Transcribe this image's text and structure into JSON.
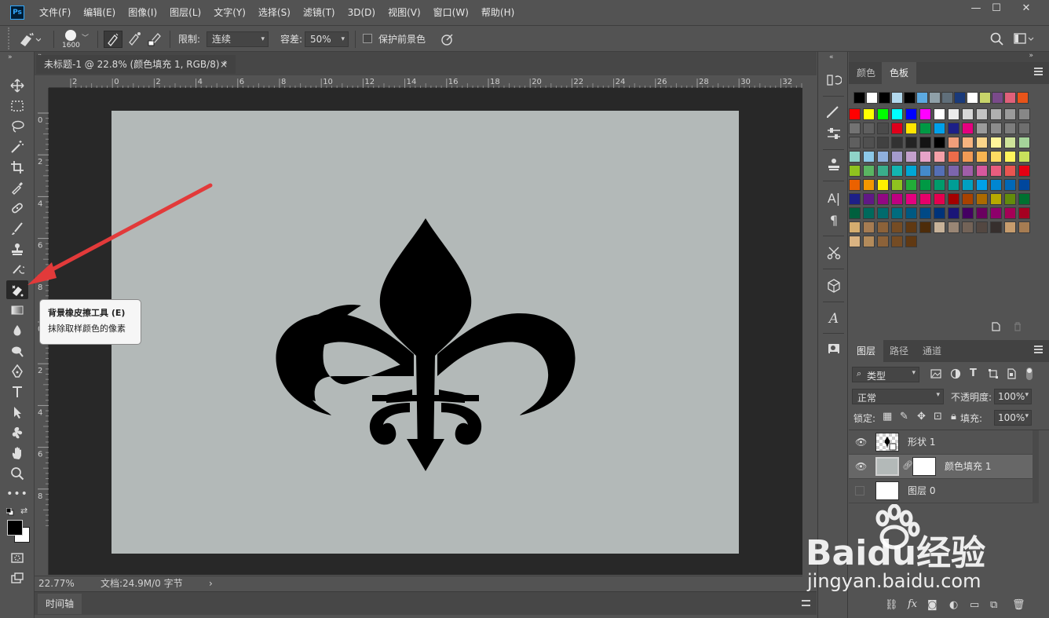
{
  "app": {
    "logo": "Ps",
    "menu": [
      "文件(F)",
      "编辑(E)",
      "图像(I)",
      "图层(L)",
      "文字(Y)",
      "选择(S)",
      "滤镜(T)",
      "3D(D)",
      "视图(V)",
      "窗口(W)",
      "帮助(H)"
    ]
  },
  "options": {
    "brush_size": "1600",
    "limit_label": "限制:",
    "limit_value": "连续",
    "tolerance_label": "容差:",
    "tolerance_value": "50%",
    "protect_label": "保护前景色"
  },
  "document": {
    "tab_title": "未标题-1 @ 22.8% (颜色填充 1, RGB/8) *",
    "close_icon": "×",
    "canvas_color": "#b3b9b8",
    "shape_color": "#000000"
  },
  "rulers": {
    "top": [
      "2",
      "0",
      "2",
      "4",
      "6",
      "8",
      "10",
      "12",
      "14",
      "16",
      "18",
      "20",
      "22",
      "24",
      "26",
      "28",
      "30",
      "32"
    ],
    "left": [
      "0",
      "2",
      "4",
      "6",
      "8",
      "0",
      "2",
      "4",
      "6",
      "8"
    ]
  },
  "tooltip": {
    "title": "背景橡皮擦工具 (E)",
    "description": "抹除取样颜色的像素"
  },
  "status": {
    "zoom": "22.77%",
    "doc_info": "文档:24.9M/0 字节",
    "arrow": "›"
  },
  "timeline": {
    "label": "时间轴"
  },
  "swatches": {
    "tabs": [
      "颜色",
      "色板"
    ],
    "active_tab": "色板",
    "recent": [
      "#000000",
      "#ffffff",
      "#000000",
      "#b3d9ee",
      "#000000",
      "#5ca9e0",
      "#8fa0a8",
      "#606f7a",
      "#1a3a7a",
      "#ffffff",
      "#c8d46a",
      "#7a4a8a",
      "#e0607a",
      "#e8541a"
    ],
    "grid": [
      [
        "#ff0000",
        "#ffff00",
        "#00ff00",
        "#00ffff",
        "#0000ff",
        "#ff00ff",
        "#ffffff",
        "#ebebeb",
        "#d7d7d7",
        "#c3c3c3",
        "#afafaf",
        "#9b9b9b",
        "#878787"
      ],
      [
        "#737373",
        "#5f5f5f",
        "#4b4b4b",
        "#e0001b",
        "#ffe500",
        "#009944",
        "#00a0e9",
        "#1d2088",
        "#e4007f",
        "#9b9b9b",
        "#8c8c8c",
        "#7d7d7d",
        "#6e6e6e"
      ],
      [
        "#5f5f5f",
        "#505050",
        "#414141",
        "#323232",
        "#232323",
        "#141414",
        "#000000",
        "#f19e7a",
        "#f6b37f",
        "#fad48a",
        "#fff59a",
        "#cfe39a",
        "#a5d49a"
      ],
      [
        "#8fd3c8",
        "#8cc8e8",
        "#8fb0dd",
        "#a49bcc",
        "#c3a0cc",
        "#e6a3c8",
        "#f4a0a8",
        "#ed6c4a",
        "#f29b55",
        "#f8b551",
        "#fcdb62",
        "#fff45c",
        "#c8e05c"
      ],
      [
        "#8fc31f",
        "#5ab562",
        "#3aae8b",
        "#13b5b1",
        "#00a7d5",
        "#448aca",
        "#556fb5",
        "#7c65ad",
        "#a05ea8",
        "#d7589e",
        "#e85d7e",
        "#ea5550",
        "#e60012"
      ],
      [
        "#eb6100",
        "#f39800",
        "#fff100",
        "#8fc31f",
        "#22ac38",
        "#009944",
        "#009b6b",
        "#009e96",
        "#00a0c1",
        "#00a0e9",
        "#0086d1",
        "#0068b7",
        "#00479d"
      ],
      [
        "#1d2088",
        "#601986",
        "#920783",
        "#be0081",
        "#e4007f",
        "#e5006a",
        "#e5004f",
        "#a40000",
        "#a84200",
        "#ac6a00",
        "#b7aa00",
        "#638c0b",
        "#007130"
      ],
      [
        "#00603e",
        "#00695c",
        "#006b6d",
        "#006c7f",
        "#005982",
        "#004986",
        "#00337a",
        "#1a1578",
        "#440062",
        "#6a005f",
        "#8e006b",
        "#a50056",
        "#a50021"
      ],
      [
        "#d4ad6f",
        "#a67c52",
        "#8c6239",
        "#754c24",
        "#603913",
        "#4d2c0a",
        "#c7b299",
        "#998675",
        "#736357",
        "#534741",
        "#362f2d",
        "#c69c6d",
        "#a67c52"
      ]
    ],
    "last_row": [
      "#d9b382",
      "#b38b5b",
      "#8c6239",
      "#754c24",
      "#603913"
    ]
  },
  "layers": {
    "tabs": [
      "图层",
      "路径",
      "通道"
    ],
    "active_tab": "图层",
    "filter_label": "类型",
    "blend_mode": "正常",
    "opacity_label": "不透明度:",
    "opacity_value": "100%",
    "lock_label": "锁定:",
    "fill_label": "填充:",
    "fill_value": "100%",
    "items": [
      {
        "name": "形状 1",
        "visible": true,
        "selected": false
      },
      {
        "name": "颜色填充 1",
        "visible": true,
        "selected": true
      },
      {
        "name": "图层 0",
        "visible": false,
        "selected": false
      }
    ]
  },
  "watermark": {
    "brand": "Baidu经验",
    "url": "jingyan.baidu.com"
  }
}
